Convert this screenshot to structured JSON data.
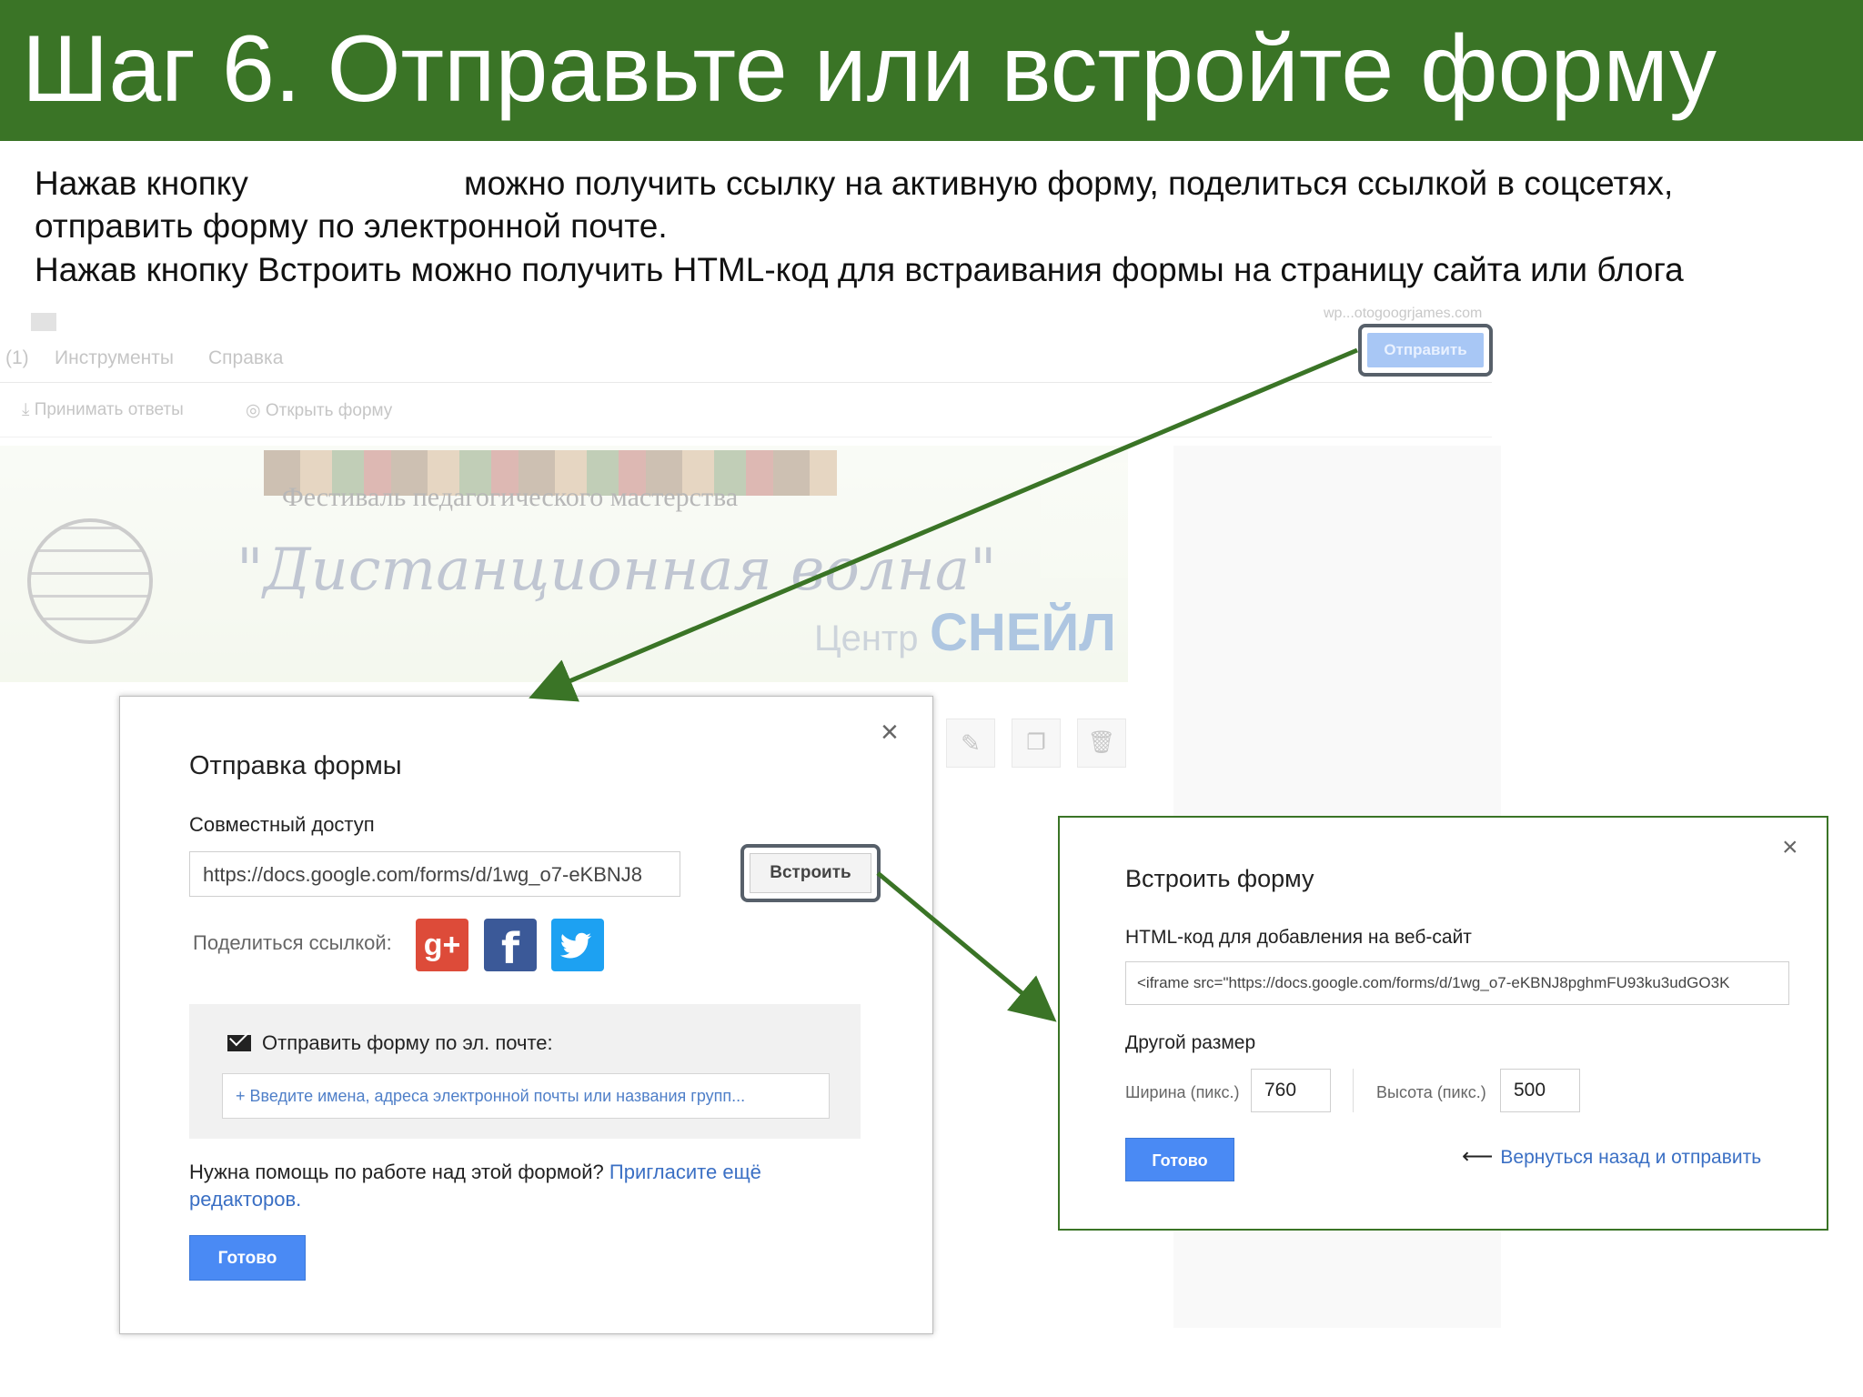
{
  "slide": {
    "title": "Шаг 6. Отправьте или встройте форму",
    "intro": {
      "line1_start": "Нажав кнопку",
      "line1_end": "можно получить ссылку на активную форму, поделиться ссылкой в соцсетях,",
      "line2": "отправить форму по электронной почте.",
      "line3": "Нажав кнопку Встроить можно получить HTML-код для встраивания формы на страницу сайта или блога"
    }
  },
  "background_editor": {
    "menu_count": "(1)",
    "menu_tools": "Инструменты",
    "menu_help": "Справка",
    "toolbar_accept": "Принимать ответы",
    "toolbar_open": "Открыть форму",
    "user_hint": "wp...otogoogrjames.com",
    "send_button": "Отправить",
    "banner_festival": "Фестиваль педагогического мастерства",
    "banner_title": "\"Дистанционная волна\"",
    "banner_centr": "Центр",
    "banner_sneil": "СНЕЙЛ"
  },
  "send_dialog": {
    "title": "Отправка формы",
    "access_label": "Совместный доступ",
    "url_value": "https://docs.google.com/forms/d/1wg_o7-eKBNJ8",
    "embed_button": "Встроить",
    "share_label": "Поделиться ссылкой:",
    "social": {
      "gplus": "g+",
      "facebook": "f",
      "twitter": "t"
    },
    "email_label": "Отправить форму по эл. почте:",
    "email_placeholder": "+ Введите имена, адреса электронной почты или названия групп...",
    "help_text": "Нужна помощь по работе над этой формой?",
    "help_link": "Пригласите ещё редакторов.",
    "done_button": "Готово",
    "close": "×"
  },
  "embed_dialog": {
    "title": "Встроить форму",
    "html_label": "HTML-код для добавления на веб-сайт",
    "code_value": "<iframe src=\"https://docs.google.com/forms/d/1wg_o7-eKBNJ8pghmFU93ku3udGO3K",
    "size_label": "Другой размер",
    "width_label": "Ширина (пикс.)",
    "width_value": "760",
    "height_label": "Высота (пикс.)",
    "height_value": "500",
    "done_button": "Готово",
    "back_link": "Вернуться назад и отправить",
    "close": "×"
  },
  "colors": {
    "banner": "#3a7426",
    "arrow": "#3a7426",
    "primary_button": "#4a8af4",
    "link": "#3a6fc4"
  }
}
